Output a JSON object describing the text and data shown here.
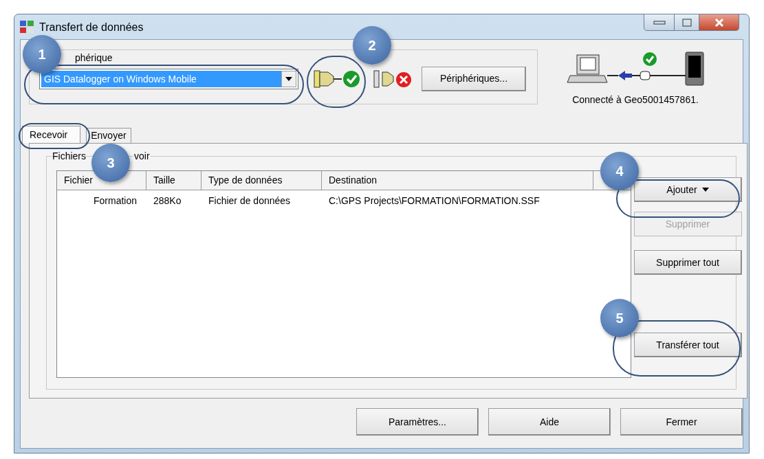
{
  "window": {
    "title": "Transfert de données"
  },
  "device_group": {
    "label": "phérique",
    "device": "GIS Datalogger on Windows Mobile",
    "buttons": [
      {
        "kind": "connect"
      },
      {
        "kind": "disconnect"
      },
      {
        "kind": "text",
        "label": "Périphériques..."
      }
    ]
  },
  "connection": {
    "status": "Connecté à Geo5001457861."
  },
  "tabs": [
    {
      "label": "Recevoir",
      "selected": true
    },
    {
      "label": "Envoyer",
      "selected": false
    }
  ],
  "files_group": {
    "legend": [
      "Fichiers",
      "voir"
    ]
  },
  "table": {
    "columns": [
      "Fichier",
      "Taille",
      "Type de données",
      "Destination"
    ],
    "rows": [
      {
        "cells": [
          "Formation",
          "288Ko",
          "Fichier de données",
          "C:\\GPS Projects\\FORMATION\\FORMATION.SSF"
        ]
      }
    ]
  },
  "side_buttons": [
    {
      "label": "Ajouter",
      "dropdown": true,
      "disabled": false
    },
    {
      "label": "Supprimer",
      "dropdown": false,
      "disabled": true
    },
    {
      "label": "Supprimer tout",
      "dropdown": false,
      "disabled": false
    },
    {
      "label": "Transférer tout",
      "dropdown": false,
      "disabled": false
    }
  ],
  "footer_buttons": [
    {
      "label": "Paramètres..."
    },
    {
      "label": "Aide"
    },
    {
      "label": "Fermer"
    }
  ],
  "callouts": [
    {
      "number": "1"
    },
    {
      "number": "2"
    },
    {
      "number": "3"
    },
    {
      "number": "4"
    },
    {
      "number": "5"
    }
  ]
}
